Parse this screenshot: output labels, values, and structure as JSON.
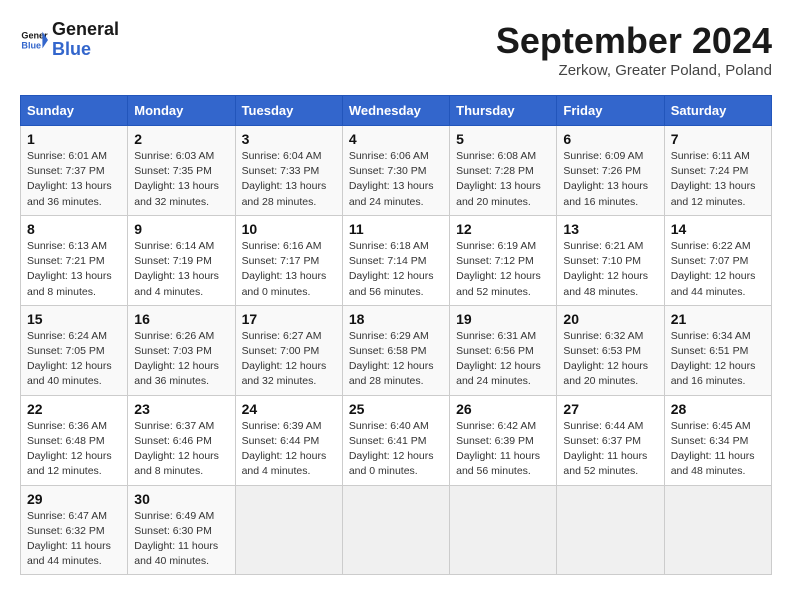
{
  "header": {
    "logo_line1": "General",
    "logo_line2": "Blue",
    "month": "September 2024",
    "location": "Zerkow, Greater Poland, Poland"
  },
  "weekdays": [
    "Sunday",
    "Monday",
    "Tuesday",
    "Wednesday",
    "Thursday",
    "Friday",
    "Saturday"
  ],
  "weeks": [
    [
      {
        "day": "1",
        "info": "Sunrise: 6:01 AM\nSunset: 7:37 PM\nDaylight: 13 hours\nand 36 minutes."
      },
      {
        "day": "2",
        "info": "Sunrise: 6:03 AM\nSunset: 7:35 PM\nDaylight: 13 hours\nand 32 minutes."
      },
      {
        "day": "3",
        "info": "Sunrise: 6:04 AM\nSunset: 7:33 PM\nDaylight: 13 hours\nand 28 minutes."
      },
      {
        "day": "4",
        "info": "Sunrise: 6:06 AM\nSunset: 7:30 PM\nDaylight: 13 hours\nand 24 minutes."
      },
      {
        "day": "5",
        "info": "Sunrise: 6:08 AM\nSunset: 7:28 PM\nDaylight: 13 hours\nand 20 minutes."
      },
      {
        "day": "6",
        "info": "Sunrise: 6:09 AM\nSunset: 7:26 PM\nDaylight: 13 hours\nand 16 minutes."
      },
      {
        "day": "7",
        "info": "Sunrise: 6:11 AM\nSunset: 7:24 PM\nDaylight: 13 hours\nand 12 minutes."
      }
    ],
    [
      {
        "day": "8",
        "info": "Sunrise: 6:13 AM\nSunset: 7:21 PM\nDaylight: 13 hours\nand 8 minutes."
      },
      {
        "day": "9",
        "info": "Sunrise: 6:14 AM\nSunset: 7:19 PM\nDaylight: 13 hours\nand 4 minutes."
      },
      {
        "day": "10",
        "info": "Sunrise: 6:16 AM\nSunset: 7:17 PM\nDaylight: 13 hours\nand 0 minutes."
      },
      {
        "day": "11",
        "info": "Sunrise: 6:18 AM\nSunset: 7:14 PM\nDaylight: 12 hours\nand 56 minutes."
      },
      {
        "day": "12",
        "info": "Sunrise: 6:19 AM\nSunset: 7:12 PM\nDaylight: 12 hours\nand 52 minutes."
      },
      {
        "day": "13",
        "info": "Sunrise: 6:21 AM\nSunset: 7:10 PM\nDaylight: 12 hours\nand 48 minutes."
      },
      {
        "day": "14",
        "info": "Sunrise: 6:22 AM\nSunset: 7:07 PM\nDaylight: 12 hours\nand 44 minutes."
      }
    ],
    [
      {
        "day": "15",
        "info": "Sunrise: 6:24 AM\nSunset: 7:05 PM\nDaylight: 12 hours\nand 40 minutes."
      },
      {
        "day": "16",
        "info": "Sunrise: 6:26 AM\nSunset: 7:03 PM\nDaylight: 12 hours\nand 36 minutes."
      },
      {
        "day": "17",
        "info": "Sunrise: 6:27 AM\nSunset: 7:00 PM\nDaylight: 12 hours\nand 32 minutes."
      },
      {
        "day": "18",
        "info": "Sunrise: 6:29 AM\nSunset: 6:58 PM\nDaylight: 12 hours\nand 28 minutes."
      },
      {
        "day": "19",
        "info": "Sunrise: 6:31 AM\nSunset: 6:56 PM\nDaylight: 12 hours\nand 24 minutes."
      },
      {
        "day": "20",
        "info": "Sunrise: 6:32 AM\nSunset: 6:53 PM\nDaylight: 12 hours\nand 20 minutes."
      },
      {
        "day": "21",
        "info": "Sunrise: 6:34 AM\nSunset: 6:51 PM\nDaylight: 12 hours\nand 16 minutes."
      }
    ],
    [
      {
        "day": "22",
        "info": "Sunrise: 6:36 AM\nSunset: 6:48 PM\nDaylight: 12 hours\nand 12 minutes."
      },
      {
        "day": "23",
        "info": "Sunrise: 6:37 AM\nSunset: 6:46 PM\nDaylight: 12 hours\nand 8 minutes."
      },
      {
        "day": "24",
        "info": "Sunrise: 6:39 AM\nSunset: 6:44 PM\nDaylight: 12 hours\nand 4 minutes."
      },
      {
        "day": "25",
        "info": "Sunrise: 6:40 AM\nSunset: 6:41 PM\nDaylight: 12 hours\nand 0 minutes."
      },
      {
        "day": "26",
        "info": "Sunrise: 6:42 AM\nSunset: 6:39 PM\nDaylight: 11 hours\nand 56 minutes."
      },
      {
        "day": "27",
        "info": "Sunrise: 6:44 AM\nSunset: 6:37 PM\nDaylight: 11 hours\nand 52 minutes."
      },
      {
        "day": "28",
        "info": "Sunrise: 6:45 AM\nSunset: 6:34 PM\nDaylight: 11 hours\nand 48 minutes."
      }
    ],
    [
      {
        "day": "29",
        "info": "Sunrise: 6:47 AM\nSunset: 6:32 PM\nDaylight: 11 hours\nand 44 minutes."
      },
      {
        "day": "30",
        "info": "Sunrise: 6:49 AM\nSunset: 6:30 PM\nDaylight: 11 hours\nand 40 minutes."
      },
      {
        "day": "",
        "info": ""
      },
      {
        "day": "",
        "info": ""
      },
      {
        "day": "",
        "info": ""
      },
      {
        "day": "",
        "info": ""
      },
      {
        "day": "",
        "info": ""
      }
    ]
  ]
}
